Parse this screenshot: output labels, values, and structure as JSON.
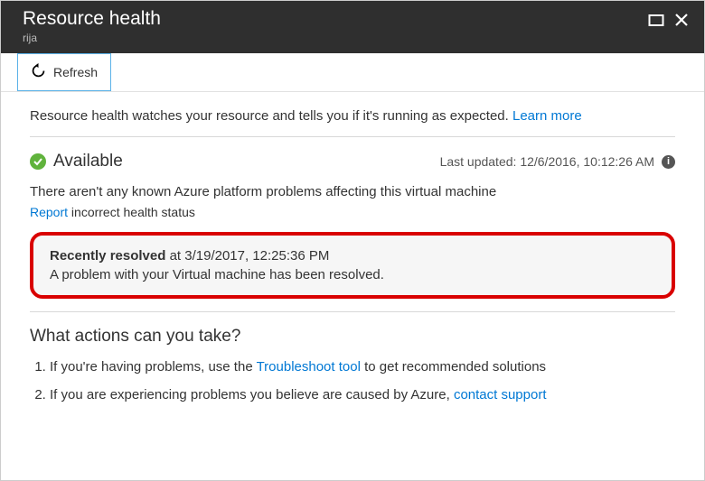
{
  "header": {
    "title": "Resource health",
    "subtitle": "rija"
  },
  "toolbar": {
    "refresh_label": "Refresh"
  },
  "intro": {
    "text": "Resource health watches your resource and tells you if it's running as expected. ",
    "learn_more": "Learn more"
  },
  "status": {
    "title": "Available",
    "last_updated_label": "Last updated: ",
    "last_updated_value": "12/6/2016, 10:12:26 AM",
    "description": "There aren't any known Azure platform problems affecting this virtual machine",
    "report_link": "Report",
    "report_rest": " incorrect health status"
  },
  "resolved": {
    "label": "Recently resolved",
    "at_text": " at 3/19/2017, 12:25:36 PM",
    "message": "A problem with your Virtual machine has been resolved."
  },
  "actions": {
    "title": "What actions can you take?",
    "item1_pre": "If you're having problems, use the ",
    "item1_link": "Troubleshoot tool",
    "item1_post": " to get recommended solutions",
    "item2_pre": "If you are experiencing problems you believe are caused by Azure, ",
    "item2_link": "contact support"
  }
}
